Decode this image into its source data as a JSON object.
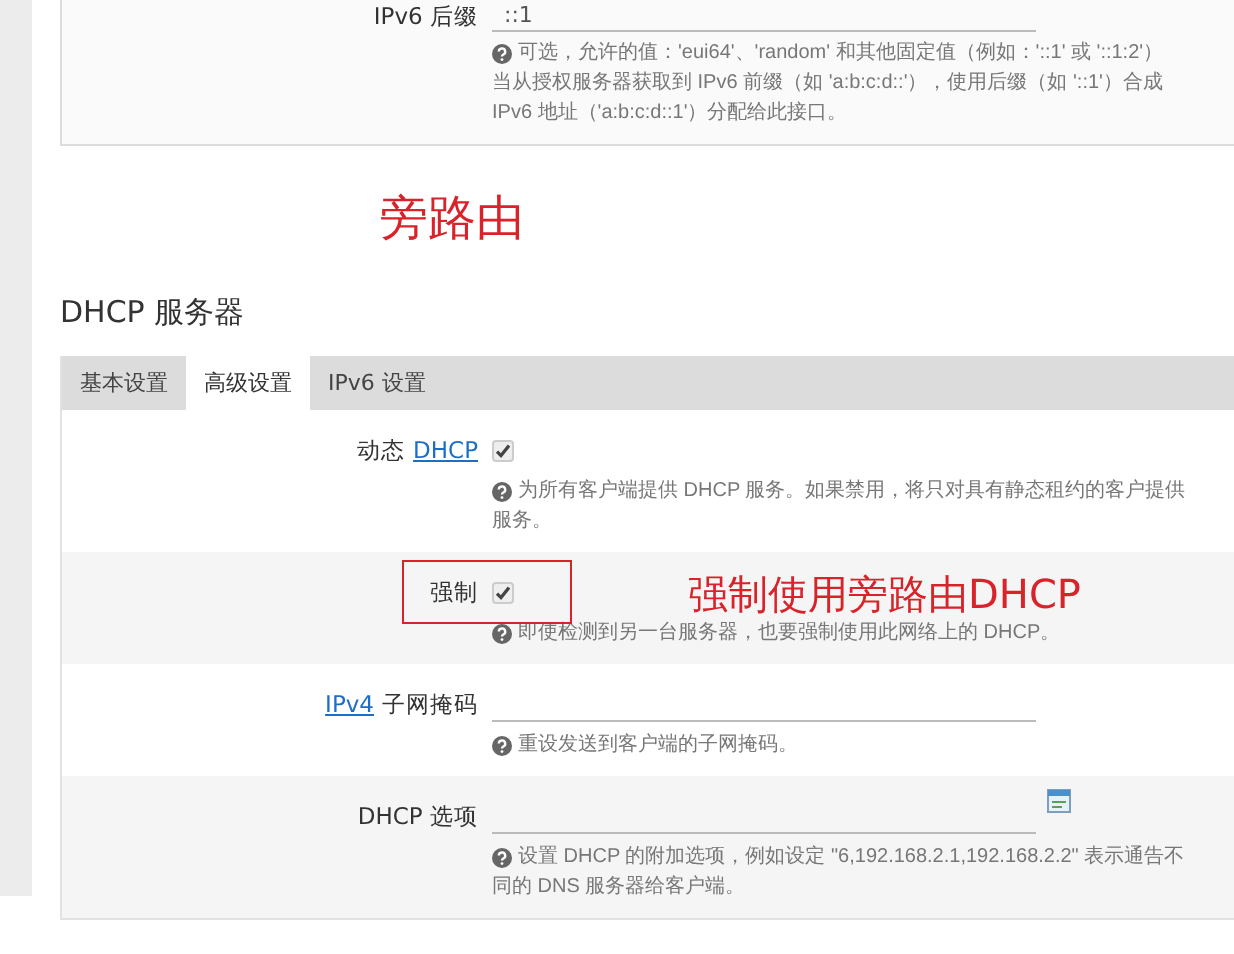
{
  "top_panel": {
    "label": "IPv6 后缀",
    "value": "::1",
    "help_lines": [
      "可选，允许的值：'eui64'、'random' 和其他固定值（例如：'::1' 或 '::1:2'）",
      "当从授权服务器获取到 IPv6 前缀（如 'a:b:c:d::'），使用后缀（如 '::1'）合成",
      "IPv6 地址（'a:b:c:d::1'）分配给此接口。"
    ]
  },
  "annotation_title": "旁路由",
  "section": {
    "title": "DHCP 服务器",
    "tabs": [
      {
        "label": "基本设置",
        "selected": false
      },
      {
        "label": "高级设置",
        "selected": true
      },
      {
        "label": "IPv6 设置",
        "selected": false
      }
    ],
    "rows": [
      {
        "kind": "checkbox",
        "label": [
          {
            "kind": "text",
            "text": "动态"
          },
          {
            "kind": "link",
            "text": "DHCP"
          }
        ],
        "checked": true,
        "help_lines": [
          "为所有客户端提供 DHCP 服务。如果禁用，将只对具有静态租约的客户提供",
          "服务。"
        ]
      },
      {
        "kind": "checkbox",
        "label": [
          {
            "kind": "text",
            "text": "强制"
          }
        ],
        "checked": true,
        "highlighted": true,
        "annotation": "强制使用旁路由DHCP",
        "help_lines": [
          "即使检测到另一台服务器，也要强制使用此网络上的 DHCP。"
        ]
      },
      {
        "kind": "input",
        "label": [
          {
            "kind": "link",
            "text": "IPv4"
          },
          {
            "kind": "text",
            "text": "子网掩码"
          }
        ],
        "help_lines": [
          "重设发送到客户端的子网掩码。"
        ]
      },
      {
        "kind": "list-input",
        "label": [
          {
            "kind": "text",
            "text": "DHCP 选项"
          }
        ],
        "help_lines": [
          "设置 DHCP 的附加选项，例如设定 \"6,192.168.2.1,192.168.2.2\" 表示通告不",
          "同的 DNS 服务器给客户端。"
        ]
      }
    ]
  }
}
